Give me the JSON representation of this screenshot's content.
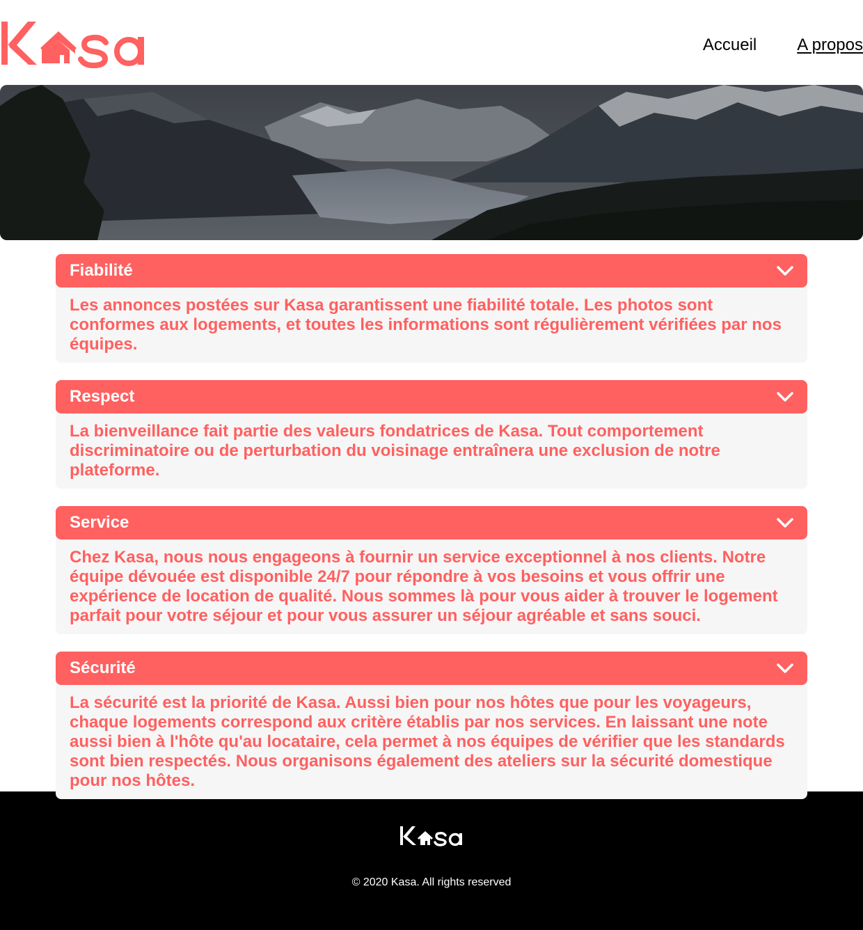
{
  "brand": {
    "name": "Kasa",
    "logo_color": "#FF6060"
  },
  "nav": {
    "home": "Accueil",
    "about": "A propos"
  },
  "colors": {
    "accent": "#FF6060",
    "panel": "#F6F6F6",
    "footer_bg": "#000000"
  },
  "sections": [
    {
      "title": "Fiabilité",
      "text": "Les annonces postées sur Kasa garantissent une fiabilité totale. Les photos sont conformes aux logements, et toutes les informations sont régulièrement vérifiées par nos équipes."
    },
    {
      "title": "Respect",
      "text": "La bienveillance fait partie des valeurs fondatrices de Kasa. Tout comportement discriminatoire ou de perturbation du voisinage entraînera une exclusion de notre plateforme."
    },
    {
      "title": "Service",
      "text": "Chez Kasa, nous nous engageons à fournir un service exceptionnel à nos clients. Notre équipe dévouée est disponible 24/7 pour répondre à vos besoins et vous offrir une expérience de location de qualité. Nous sommes là pour vous aider à trouver le logement parfait pour votre séjour et pour vous assurer un séjour agréable et sans souci."
    },
    {
      "title": "Sécurité",
      "text": "La sécurité est la priorité de Kasa. Aussi bien pour nos hôtes que pour les voyageurs, chaque logements correspond aux critère établis par nos services. En laissant une note aussi bien à l'hôte qu'au locataire, cela permet à nos équipes de vérifier que les standards sont bien respectés. Nous organisons également des ateliers sur la sécurité domestique pour nos hôtes."
    }
  ],
  "footer": {
    "copyright": "© 2020 Kasa. All rights reserved"
  }
}
